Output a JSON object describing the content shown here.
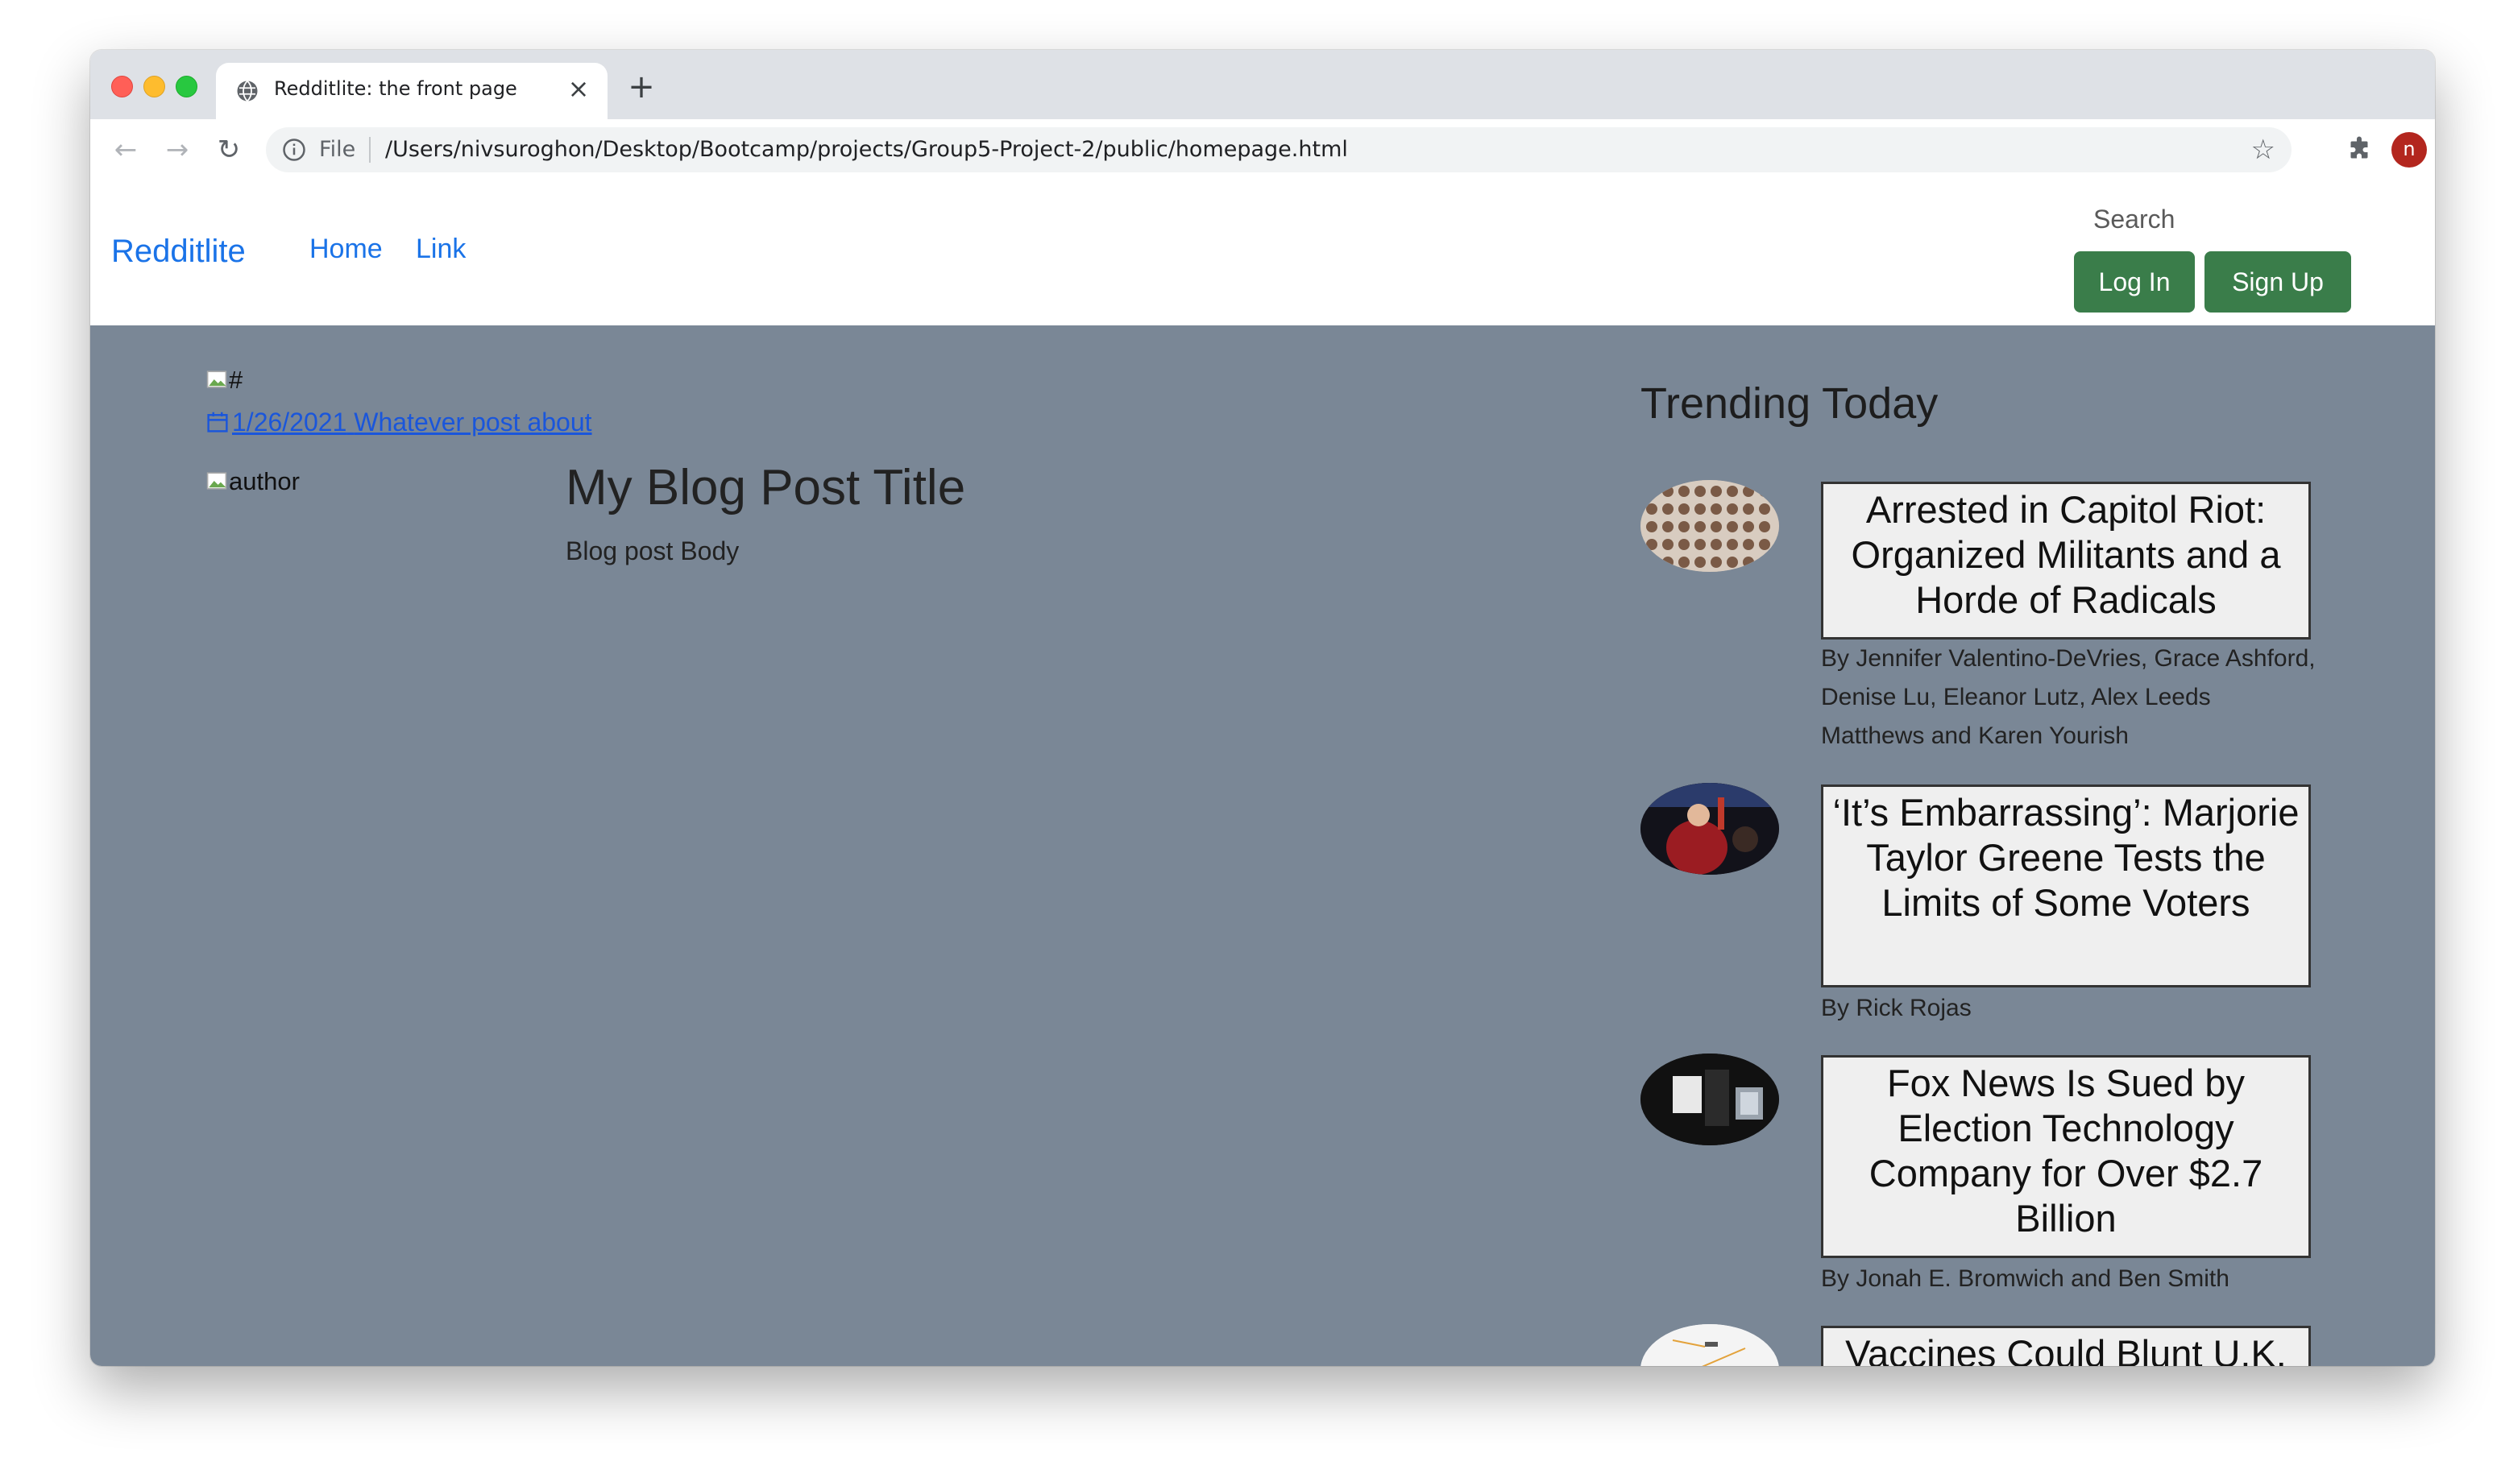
{
  "browser": {
    "tab_title": "Redditlite: the front page",
    "new_tab_symbol": "+",
    "close_symbol": "×",
    "file_label": "File",
    "url": "/Users/nivsuroghon/Desktop/Bootcamp/projects/Group5-Project-2/public/homepage.html",
    "profile_initial": "n"
  },
  "navbar": {
    "brand": "Redditlite",
    "links": [
      "Home",
      "Link"
    ],
    "search_label": "Search",
    "login_label": "Log In",
    "signup_label": "Sign Up"
  },
  "post": {
    "image_alt": "#",
    "date": "1/26/2021",
    "topic": "Whatever post about",
    "author_alt": "author",
    "title": "My Blog Post Title",
    "body": "Blog post Body"
  },
  "trending": {
    "heading": "Trending Today",
    "articles": [
      {
        "title": "Arrested in Capitol Riot: Organized Militants and a Horde of Radicals",
        "byline": "By Jennifer Valentino-DeVries, Grace Ashford, Denise Lu, Eleanor Lutz, Alex Leeds Matthews and Karen Yourish"
      },
      {
        "title": "‘It’s Embarrassing’: Marjorie Taylor Greene Tests the Limits of Some Voters",
        "byline": "By Rick Rojas"
      },
      {
        "title": "Fox News Is Sued by Election Technology Company for Over $2.7 Billion",
        "byline": "By Jonah E. Bromwich and Ben Smith"
      },
      {
        "title": "Vaccines Could Blunt U.K. Epidemic in Weeks",
        "byline": ""
      }
    ]
  },
  "colors": {
    "page_background": "#7a8796",
    "brand_link": "#1a73e8",
    "button_green": "#3a7d4a"
  }
}
